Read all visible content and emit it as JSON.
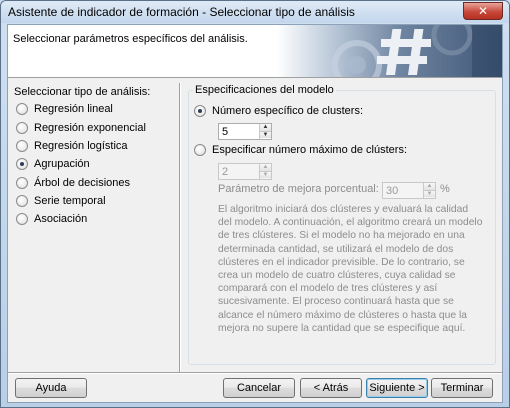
{
  "window": {
    "title": "Asistente de indicador de formación - Seleccionar tipo de análisis",
    "close_glyph": "✕"
  },
  "header": {
    "subtitle": "Seleccionar parámetros específicos del análisis."
  },
  "analysis_types": {
    "label": "Seleccionar tipo de análisis:",
    "selected": "Agrupación",
    "items": [
      {
        "label": "Regresión lineal",
        "checked": false
      },
      {
        "label": "Regresión exponencial",
        "checked": false
      },
      {
        "label": "Regresión logística",
        "checked": false
      },
      {
        "label": "Agrupación",
        "checked": true
      },
      {
        "label": "Árbol de decisiones",
        "checked": false
      },
      {
        "label": "Serie temporal",
        "checked": false
      },
      {
        "label": "Asociación",
        "checked": false
      }
    ]
  },
  "model_spec": {
    "group_title": "Especificaciones del modelo",
    "specific_clusters": {
      "label": "Número específico de clusters:",
      "checked": true,
      "value": "5"
    },
    "max_clusters": {
      "label": "Especificar número máximo de clústers:",
      "checked": false,
      "value": "2"
    },
    "improvement": {
      "label": "Parámetro de mejora porcentual:",
      "value": "30",
      "unit": "%"
    },
    "description": "El algoritmo iniciará dos clústeres y evaluará la calidad del modelo. A continuación, el algoritmo creará un modelo de tres clústeres. Si el modelo no ha mejorado en una determinada cantidad, se utilizará el modelo de dos clústeres en el indicador previsible. De lo contrario, se crea un modelo de cuatro clústeres, cuya calidad se comparará con el modelo de tres clústeres y así sucesivamente. El proceso continuará hasta que se alcance el número máximo de clústeres o hasta que la mejora no supere la cantidad que se especifique aquí."
  },
  "buttons": {
    "help": "Ayuda",
    "cancel": "Cancelar",
    "back": "< Atrás",
    "next": "Siguiente >",
    "finish": "Terminar"
  },
  "icons": {
    "banner": "gear-hash-banner-graphic"
  }
}
